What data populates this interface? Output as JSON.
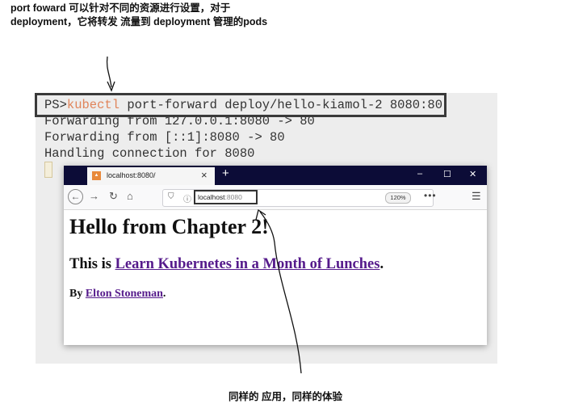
{
  "annotations": {
    "top_line1": "port foward 可以针对不同的资源进行设置，对于",
    "top_line2": "deployment，它将转发 流量到 deployment 管理的pods",
    "bottom": "同样的 应用，同样的体验"
  },
  "terminal": {
    "prompt": "PS>",
    "command_keyword": "kubectl",
    "command_rest": " port-forward deploy/hello-kiamol-2 8080:80",
    "output": [
      "Forwarding from 127.0.0.1:8080 -> 80",
      "Forwarding from [::1]:8080 -> 80",
      "Handling connection for 8080"
    ]
  },
  "browser": {
    "tab_title": "localhost:8080/",
    "tab_close": "×",
    "new_tab": "+",
    "window_controls": [
      "–",
      "☐",
      "✕"
    ],
    "url_host": "localhost",
    "url_port": ":8080",
    "zoom": "120%",
    "more": "•••",
    "page": {
      "heading": "Hello from Chapter 2!",
      "subheading_prefix": "This is ",
      "subheading_link": "Learn Kubernetes in a Month of Lunches",
      "subheading_suffix": ".",
      "byline_prefix": "By ",
      "byline_link": "Elton Stoneman",
      "byline_suffix": "."
    }
  },
  "colors": {
    "titlebar": "#0c0c37",
    "kubectl": "#e0845a",
    "link": "#551a8b"
  }
}
